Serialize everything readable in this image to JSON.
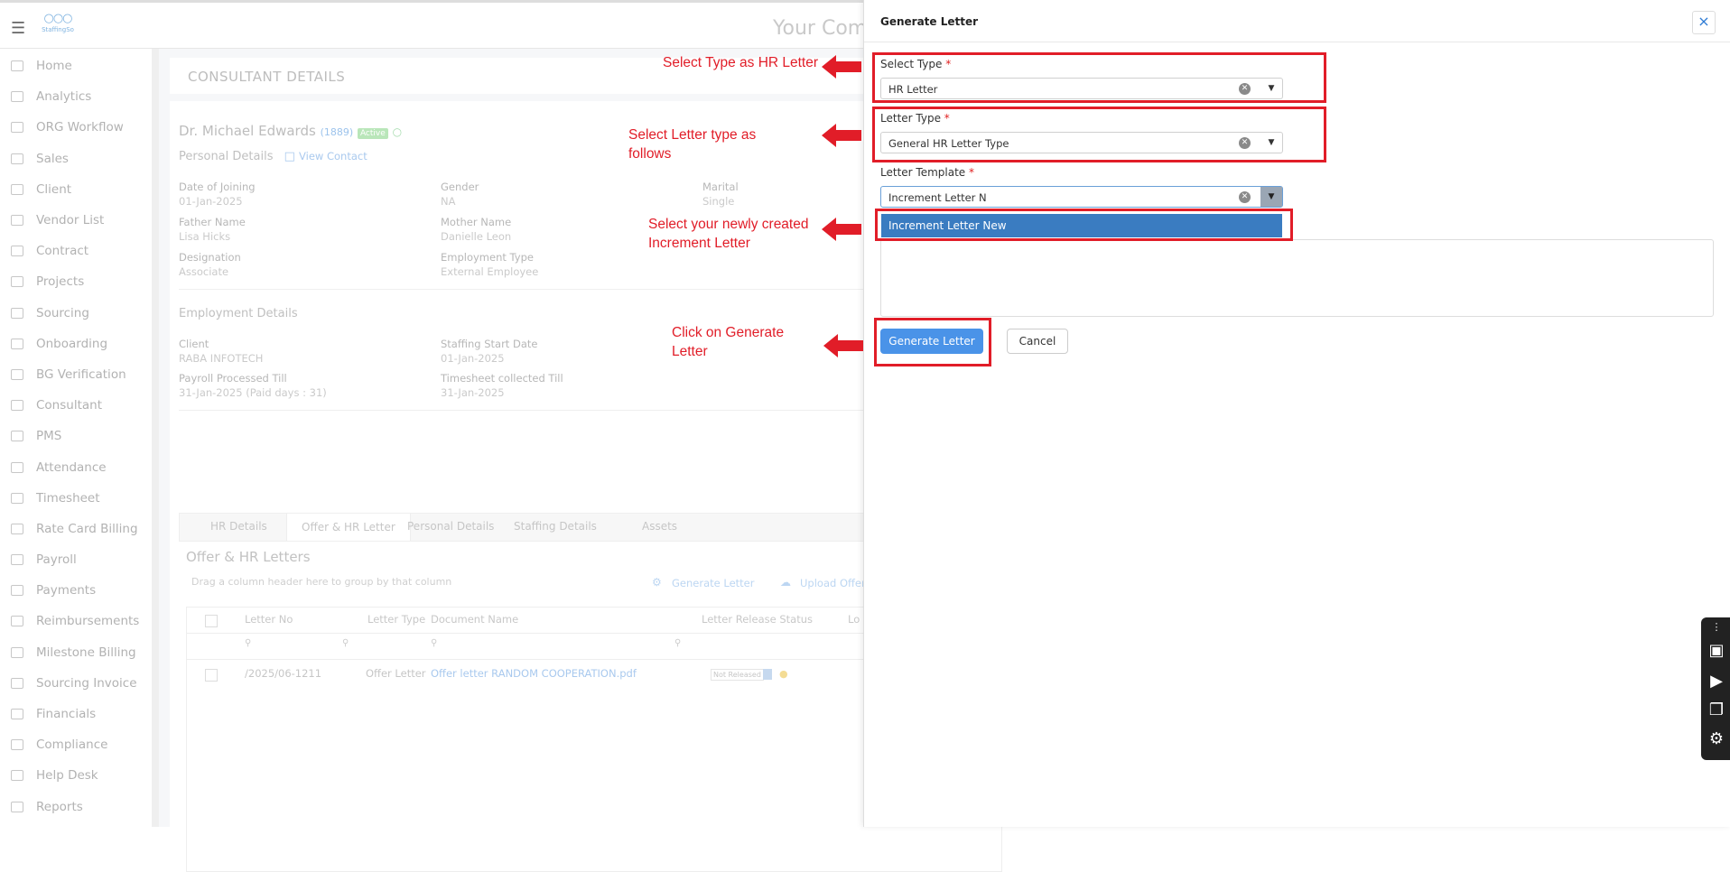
{
  "header": {
    "logo_text": "StaffingSo",
    "company_name": "Your Comp"
  },
  "sidebar": {
    "items": [
      {
        "label": "Home"
      },
      {
        "label": "Analytics"
      },
      {
        "label": "ORG Workflow"
      },
      {
        "label": "Sales"
      },
      {
        "label": "Client"
      },
      {
        "label": "Vendor List"
      },
      {
        "label": "Contract"
      },
      {
        "label": "Projects"
      },
      {
        "label": "Sourcing"
      },
      {
        "label": "Onboarding"
      },
      {
        "label": "BG Verification"
      },
      {
        "label": "Consultant"
      },
      {
        "label": "PMS"
      },
      {
        "label": "Attendance"
      },
      {
        "label": "Timesheet"
      },
      {
        "label": "Rate Card Billing"
      },
      {
        "label": "Payroll"
      },
      {
        "label": "Payments"
      },
      {
        "label": "Reimbursements"
      },
      {
        "label": "Milestone Billing"
      },
      {
        "label": "Sourcing Invoice"
      },
      {
        "label": "Financials"
      },
      {
        "label": "Compliance"
      },
      {
        "label": "Help Desk"
      },
      {
        "label": "Reports"
      }
    ]
  },
  "consultant": {
    "section_title": "CONSULTANT DETAILS",
    "name": "Dr. Michael Edwards",
    "code": "(1889)",
    "status": "Active",
    "personal_details_label": "Personal Details",
    "view_contact": "View Contact",
    "fields": {
      "doj_label": "Date of Joining",
      "doj": "01-Jan-2025",
      "gender_label": "Gender",
      "gender": "NA",
      "marital_label": "Marital",
      "marital": "Single",
      "father_label": "Father Name",
      "father": "Lisa Hicks",
      "mother_label": "Mother Name",
      "mother": "Danielle Leon",
      "designation_label": "Designation",
      "designation": "Associate",
      "emptype_label": "Employment Type",
      "emptype": "External Employee"
    },
    "employment": {
      "title": "Employment Details",
      "client_label": "Client",
      "client": "RABA INFOTECH",
      "start_label": "Staffing Start Date",
      "start": "01-Jan-2025",
      "payroll_label": "Payroll Processed Till",
      "payroll": "31-Jan-2025 (Paid days : 31)",
      "timesheet_label": "Timesheet collected Till",
      "timesheet": "31-Jan-2025"
    },
    "tabs": [
      "HR Details",
      "Offer & HR Letter",
      "Personal Details",
      "Staffing Details",
      "Assets"
    ],
    "letters": {
      "title": "Offer & HR Letters",
      "group_hint": "Drag a column header here to group by that column",
      "generate_link": "Generate Letter",
      "upload_link": "Upload Offer",
      "columns": [
        "Letter No",
        "Letter Type",
        "Document Name",
        "Letter Release Status",
        "Lo"
      ],
      "row": {
        "letter_no": "/2025/06-1211",
        "letter_type": "Offer Letter",
        "document": "Offer letter RANDOM COOPERATION.pdf",
        "release_status": "Not Released"
      }
    }
  },
  "drawer": {
    "title": "Generate Letter",
    "close": "×",
    "select_type_label": "Select Type",
    "select_type_value": "HR Letter",
    "letter_type_label": "Letter Type",
    "letter_type_value": "General HR Letter Type",
    "template_label": "Letter Template",
    "template_value": "Increment Letter N",
    "template_option": "Increment Letter New",
    "required_mark": "*",
    "generate_button": "Generate Letter",
    "cancel_button": "Cancel"
  },
  "annotations": {
    "note1": "Select Type as HR Letter",
    "note2": "Select Letter type as follows",
    "note3": "Select your newly created Increment Letter",
    "note4": "Click on Generate Letter"
  },
  "colors": {
    "annotation": "#e11d28",
    "primary_button": "#4a93e8",
    "selected_option": "#3a7cc1"
  }
}
